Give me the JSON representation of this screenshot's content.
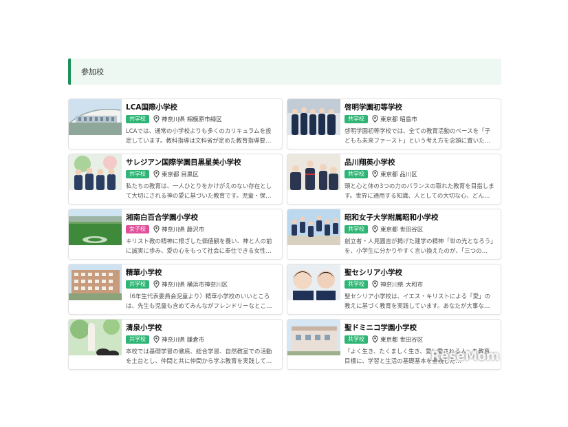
{
  "section": {
    "title": "参加校"
  },
  "schools": [
    {
      "name": "LCA国際小学校",
      "type": "共学校",
      "location": "神奈川県 相模原市緑区",
      "desc": "LCAでは、通常の小学校よりも多くのカリキュラムを設定しています。教科指導は文科省が定めた教育指導要…"
    },
    {
      "name": "啓明学園初等学校",
      "type": "共学校",
      "location": "東京都 昭島市",
      "desc": "啓明学園初等学校では、全ての教育活動のベースを「子どもも未来ファースト」という考え方を念頭に置いた「子…"
    },
    {
      "name": "サレジアン国際学園目黒星美小学校",
      "type": "共学校",
      "location": "東京都 目黒区",
      "desc": "私たちの教育は、一人ひとりをかけがえのない存在として大切にされる神の愛に基づいた教育です。児童・保護…"
    },
    {
      "name": "品川翔英小学校",
      "type": "共学校",
      "location": "東京都 品川区",
      "desc": "頭と心と体の3つの力のバランスの取れた教育を目指します。世界に通用する知識、人としての大切な心、どん…"
    },
    {
      "name": "湘南白百合学園小学校",
      "type": "女子校",
      "location": "神奈川県 藤沢市",
      "desc": "キリスト教の精神に根ざした価値観を養い、神と人の前に誠実に歩み、愛の心をもって社会に奉仕できる女性を…"
    },
    {
      "name": "昭和女子大学附属昭和小学校",
      "type": "共学校",
      "location": "東京都 世田谷区",
      "desc": "創立者・人見圓吉が掲げた建学の精神「世の光となろう」を、小学生に分かりやすく言い換えたのが、「三つの…"
    },
    {
      "name": "精華小学校",
      "type": "共学校",
      "location": "神奈川県 横浜市神奈川区",
      "desc": "（6年生代表委員会児童より）精華小学校のいいところは、先生も児童も含めてみんながフレンドリーなところ…"
    },
    {
      "name": "聖セシリア小学校",
      "type": "共学校",
      "location": "神奈川県 大和市",
      "desc": "聖セシリア小学校は、イエス・キリストによる「愛」の教えに基づく教育を実践しています。あなたが大事な人…"
    },
    {
      "name": "清泉小学校",
      "type": "共学校",
      "location": "神奈川県 鎌倉市",
      "desc": "本校では基礎学習の徹底、総合学習、自然教室での活動を土台とし、仲間と共に仲間から学ぶ教育を実践してい…"
    },
    {
      "name": "聖ドミニコ学園小学校",
      "type": "共学校",
      "location": "東京都 世田谷区",
      "desc": "「よく生き、たくましく生き、愛し愛される人」を教育目標に、学習と生活の基礎基本を重視した…"
    }
  ],
  "watermark": "ReseMom"
}
